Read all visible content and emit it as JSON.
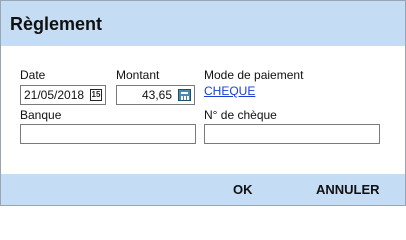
{
  "dialog": {
    "title": "Règlement"
  },
  "fields": {
    "date_label": "Date",
    "date_value": "21/05/2018",
    "date_icon_text": "15",
    "montant_label": "Montant",
    "montant_value": "43,65",
    "mode_label": "Mode de paiement",
    "mode_value": "CHEQUE",
    "banque_label": "Banque",
    "banque_value": "",
    "cheque_label": "N° de chèque",
    "cheque_value": ""
  },
  "buttons": {
    "ok": "OK",
    "cancel": "ANNULER"
  },
  "colors": {
    "header_bg": "#c5dcf5",
    "link": "#1a3fd6"
  },
  "icons": {
    "date": "calendar-icon",
    "amount": "calculator-icon"
  }
}
